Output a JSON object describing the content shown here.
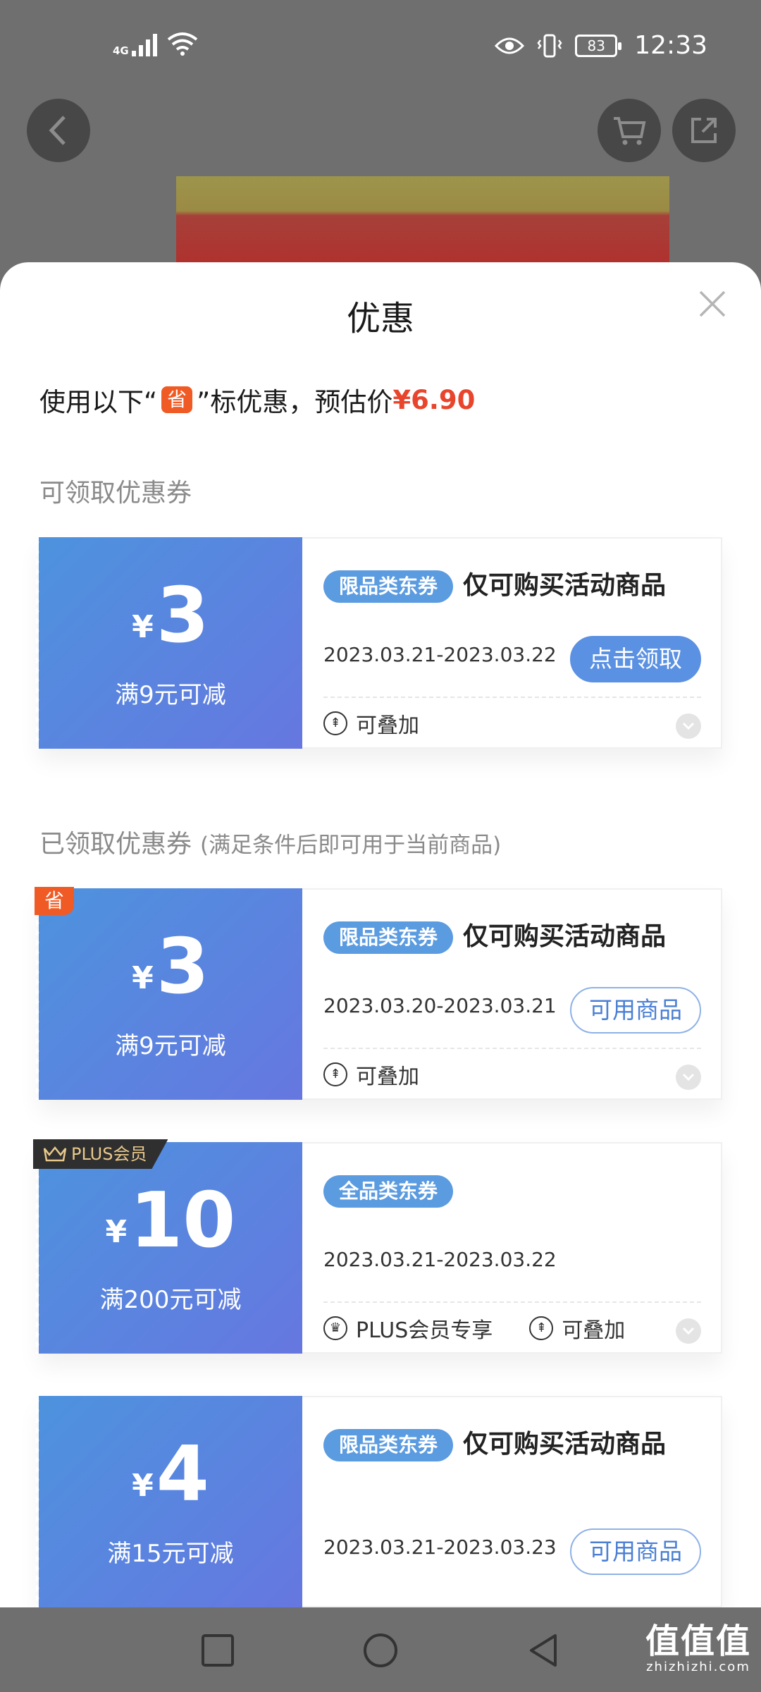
{
  "status_bar": {
    "network": "4G",
    "battery": "83",
    "time": "12:33"
  },
  "sheet": {
    "title": "优惠",
    "summary_prefix": "使用以下“",
    "summary_badge": "省",
    "summary_suffix": "”标优惠，预估价",
    "price": "¥6.90"
  },
  "sections": {
    "available_label": "可领取优惠券",
    "received_label": "已领取优惠券",
    "received_note": "(满足条件后即可用于当前商品)"
  },
  "coupons": [
    {
      "yen": "¥",
      "amount": "3",
      "condition": "满9元可减",
      "tag": "限品类东券",
      "desc": "仅可购买活动商品",
      "date": "2023.03.21-2023.03.22",
      "button": "点击领取",
      "stack": "可叠加"
    },
    {
      "corner": "省",
      "yen": "¥",
      "amount": "3",
      "condition": "满9元可减",
      "tag": "限品类东券",
      "desc": "仅可购买活动商品",
      "date": "2023.03.20-2023.03.21",
      "button": "可用商品",
      "stack": "可叠加"
    },
    {
      "corner": "PLUS会员",
      "yen": "¥",
      "amount": "10",
      "condition": "满200元可减",
      "tag": "全品类东券",
      "date": "2023.03.21-2023.03.22",
      "plus_label": "PLUS会员专享",
      "stack": "可叠加"
    },
    {
      "yen": "¥",
      "amount": "4",
      "condition": "满15元可减",
      "tag": "限品类东券",
      "desc": "仅可购买活动商品",
      "date": "2023.03.21-2023.03.23",
      "button": "可用商品"
    }
  ],
  "watermark": {
    "line1": "值值值",
    "line2": "zhizhizhi.com"
  },
  "colors": {
    "accent": "#5b91e2",
    "price_red": "#e8452c",
    "badge_orange": "#f05a24"
  }
}
